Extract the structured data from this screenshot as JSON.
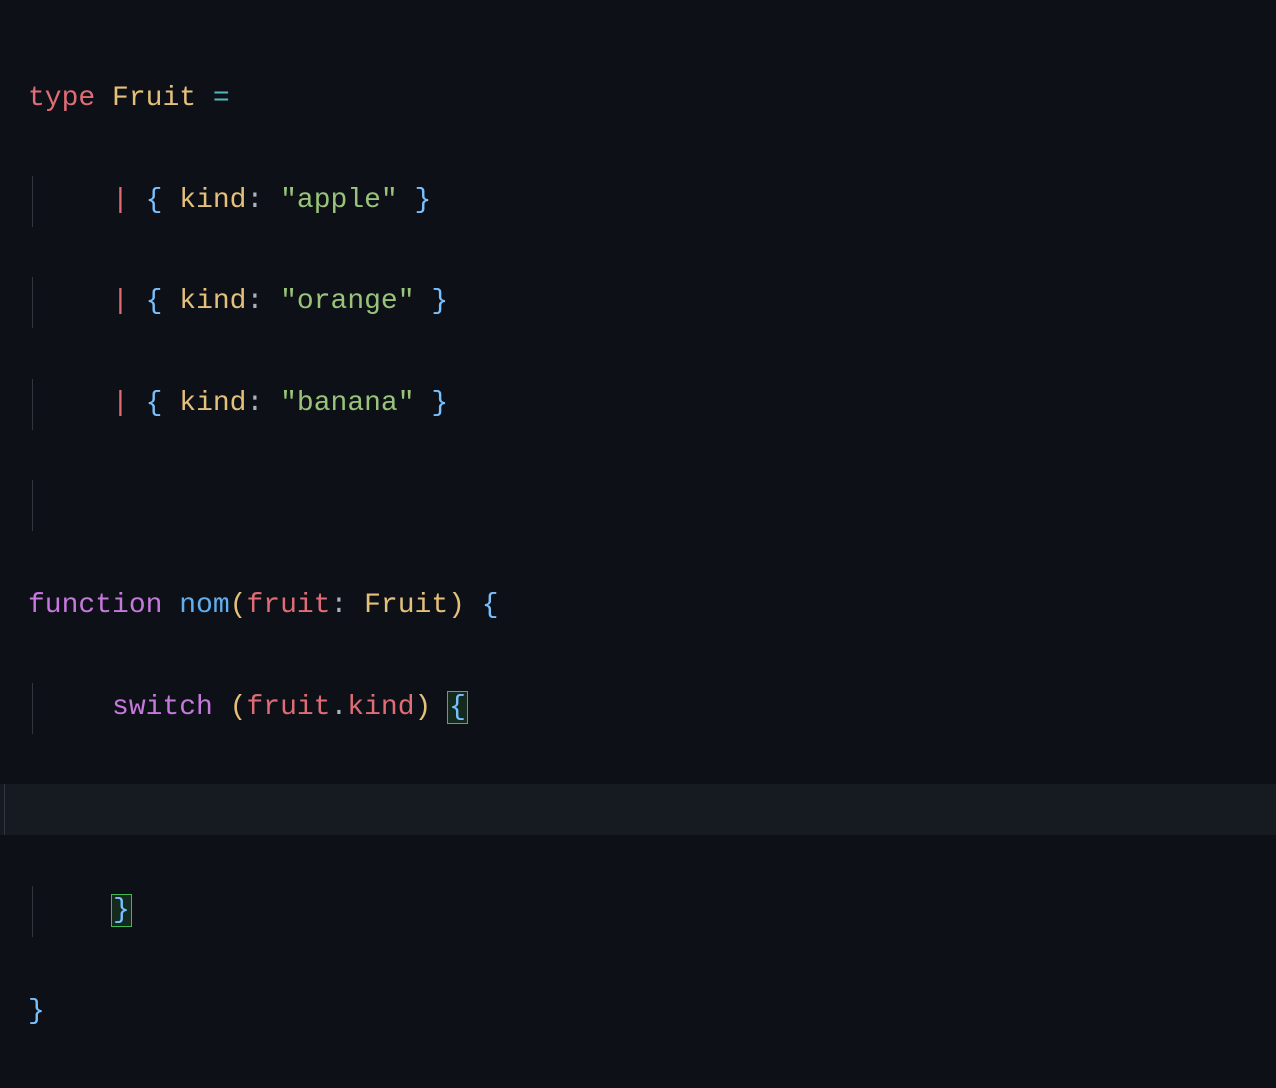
{
  "code": {
    "line1": {
      "type_kw": "type",
      "type_name": "Fruit",
      "equals": "="
    },
    "line2": {
      "pipe": "|",
      "lbrace": "{",
      "prop": "kind",
      "colon": ":",
      "str": "\"apple\"",
      "rbrace": "}"
    },
    "line3": {
      "pipe": "|",
      "lbrace": "{",
      "prop": "kind",
      "colon": ":",
      "str": "\"orange\"",
      "rbrace": "}"
    },
    "line4": {
      "pipe": "|",
      "lbrace": "{",
      "prop": "kind",
      "colon": ":",
      "str": "\"banana\"",
      "rbrace": "}"
    },
    "line6": {
      "fn_kw": "function",
      "fn_name": "nom",
      "lparen": "(",
      "param": "fruit",
      "colon": ":",
      "param_type": "Fruit",
      "rparen": ")",
      "lbrace": "{"
    },
    "line7": {
      "switch_kw": "switch",
      "lparen": "(",
      "var": "fruit",
      "dot": ".",
      "member": "kind",
      "rparen": ")",
      "lbrace": "{"
    },
    "line9": {
      "rbrace": "}"
    },
    "line10": {
      "rbrace": "}"
    }
  }
}
